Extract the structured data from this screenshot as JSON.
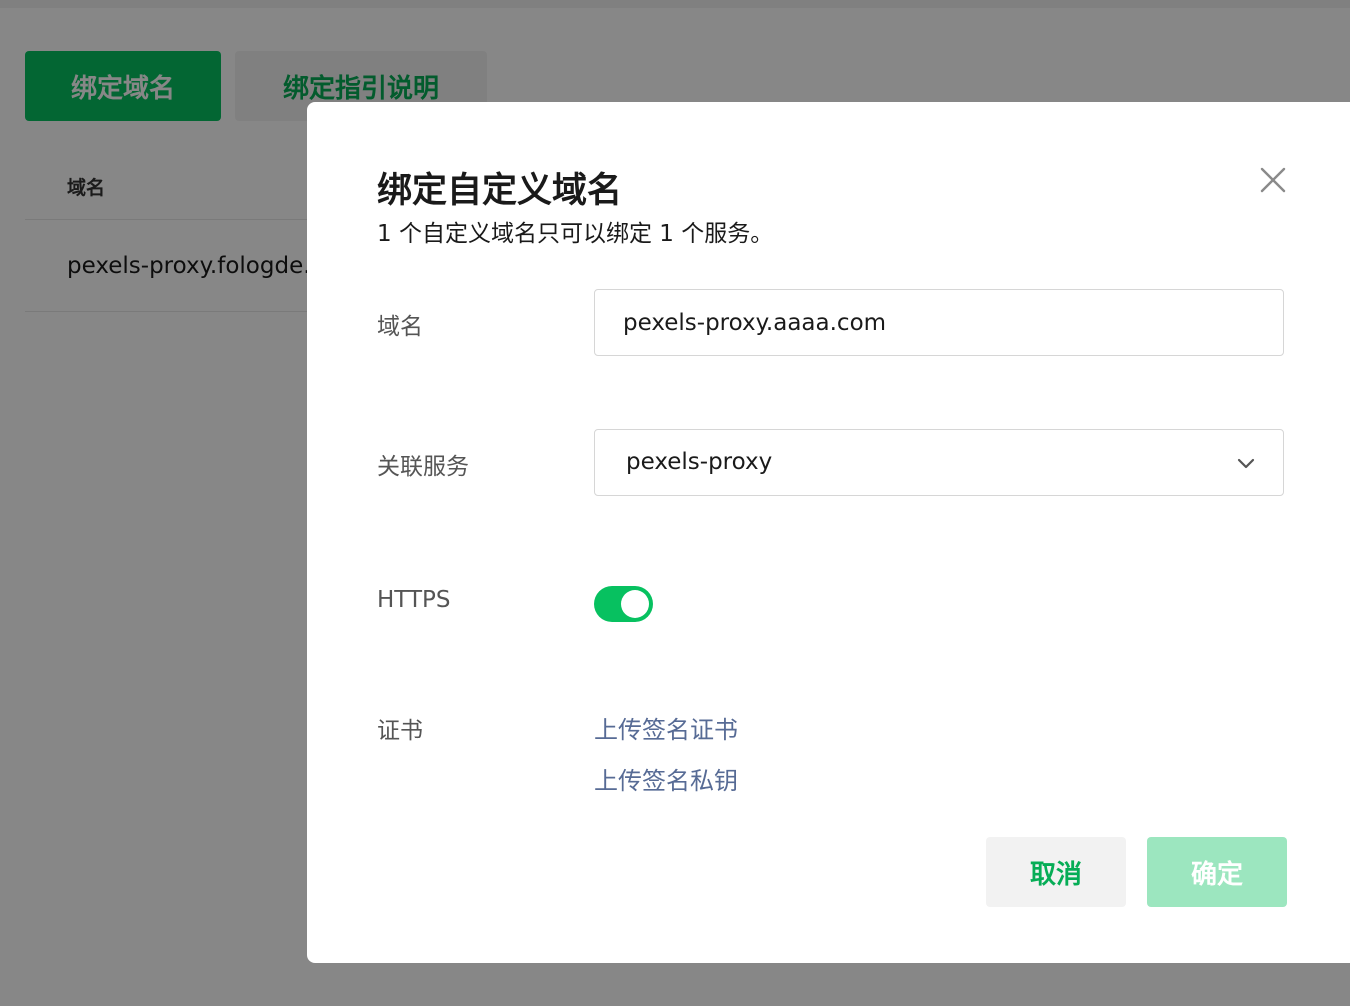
{
  "background": {
    "tabs": [
      "绑定域名",
      "绑定指引说明"
    ],
    "table": {
      "header": "域名",
      "rows": [
        "pexels-proxy.fologde.c"
      ]
    }
  },
  "modal": {
    "title": "绑定自定义域名",
    "subtitle": "1 个自定义域名只可以绑定 1 个服务。",
    "close_icon": "close-icon",
    "domain": {
      "label": "域名",
      "value": "pexels-proxy.aaaa.com"
    },
    "service": {
      "label": "关联服务",
      "value": "pexels-proxy",
      "icon": "chevron-down-icon"
    },
    "https": {
      "label": "HTTPS",
      "enabled": true
    },
    "certificate": {
      "label": "证书",
      "upload_cert": "上传签名证书",
      "upload_key": "上传签名私钥"
    },
    "buttons": {
      "cancel": "取消",
      "confirm": "确定"
    }
  },
  "colors": {
    "brand_green": "#07c160",
    "link_blue": "#576b95",
    "disabled_green": "#9ce6bf"
  }
}
